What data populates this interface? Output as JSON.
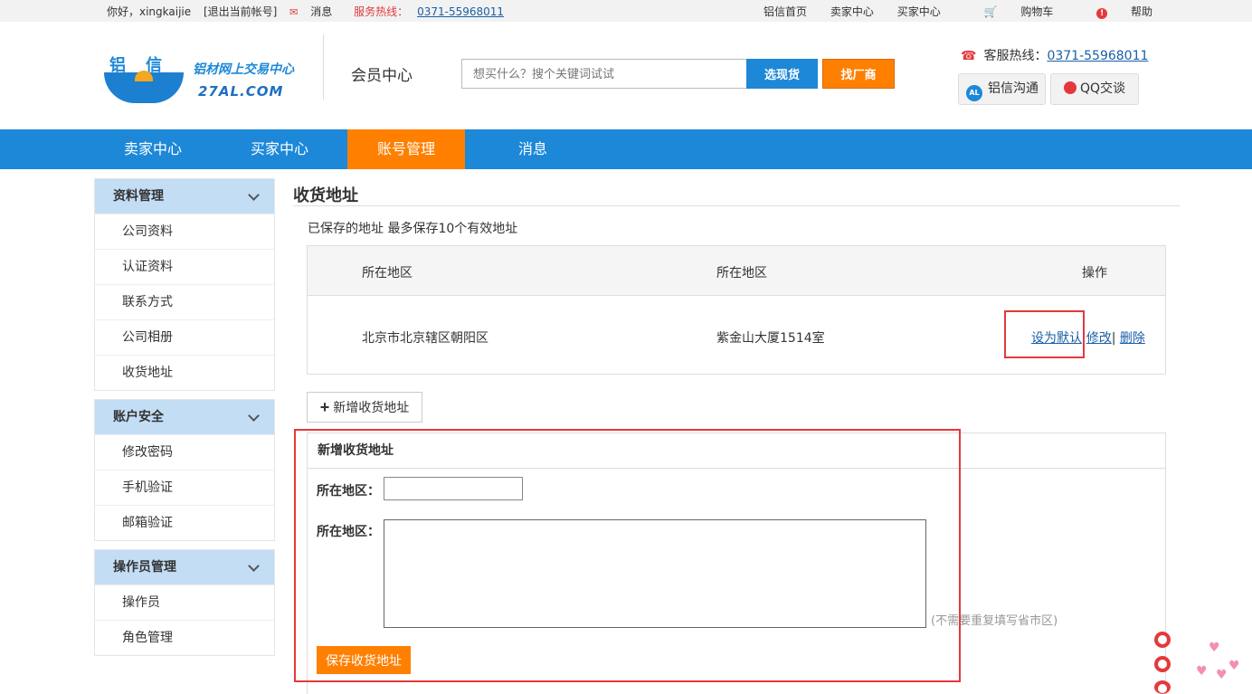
{
  "topbar": {
    "greeting": "你好，xingkaijie",
    "logout": "[退出当前帐号]",
    "messages": "消息",
    "hotline_label": "服务热线：",
    "hotline_number": "0371-55968011",
    "links": [
      "铝信首页",
      "卖家中心",
      "买家中心",
      "购物车",
      "帮助"
    ]
  },
  "header": {
    "logo_chars": "铝信",
    "logo_slogan": "铝材网上交易中心",
    "logo_domain": "27AL.COM",
    "member_center": "会员中心",
    "search_placeholder": "想买什么？搜个关键词试试",
    "btn_select": "选现货",
    "btn_factory": "找厂商",
    "service_label": "客服热线：",
    "service_number": "0371-55968011",
    "chat_al_badge": "AL",
    "chat_al": "铝信沟通",
    "chat_qq": "QQ交谈"
  },
  "nav": {
    "items": [
      "卖家中心",
      "买家中心",
      "账号管理",
      "消息"
    ],
    "active": "账号管理"
  },
  "sidebar": {
    "groups": [
      {
        "title": "资料管理",
        "items": [
          "公司资料",
          "认证资料",
          "联系方式",
          "公司相册",
          "收货地址"
        ]
      },
      {
        "title": "账户安全",
        "items": [
          "修改密码",
          "手机验证",
          "邮箱验证"
        ]
      },
      {
        "title": "操作员管理",
        "items": [
          "操作员",
          "角色管理"
        ]
      }
    ]
  },
  "main": {
    "title": "收货地址",
    "saved_note": "已保存的地址 最多保存10个有效地址",
    "table": {
      "headers": [
        "所在地区",
        "所在地区",
        "操作"
      ],
      "rows": [
        {
          "region": "北京市北京辖区朝阳区",
          "address": "紫金山大厦1514室",
          "op_default": "设为默认",
          "op_edit": "修改",
          "op_delete": "删除"
        }
      ]
    },
    "add_button": "新增收货地址",
    "form": {
      "title": "新增收货地址",
      "label_region": "所在地区：",
      "label_address": "所在地区：",
      "hint": "(不需要重复填写省市区)",
      "save_button": "保存收货地址"
    }
  },
  "colors": {
    "primary_blue": "#1d88d8",
    "accent_orange": "#ff7f00",
    "highlight_red": "#e4393c"
  }
}
